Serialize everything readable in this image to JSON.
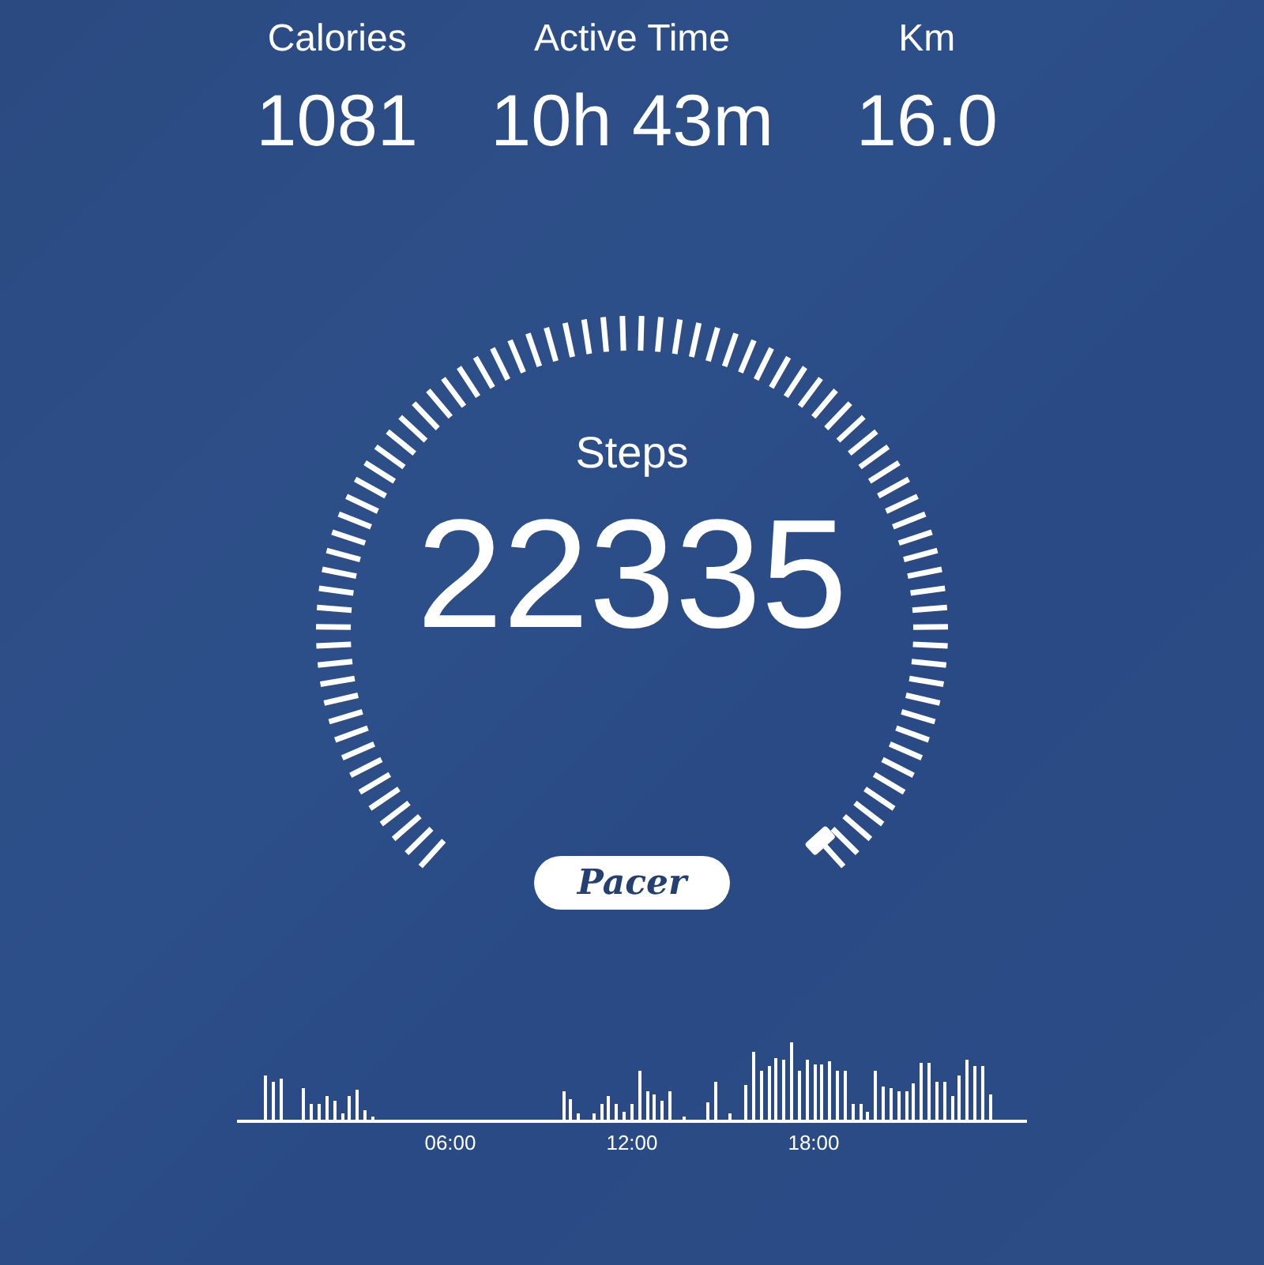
{
  "stats": [
    {
      "label": "Calories",
      "value": "1081"
    },
    {
      "label": "Active Time",
      "value": "10h 43m"
    },
    {
      "label": "Km",
      "value": "16.0"
    }
  ],
  "gauge": {
    "label": "Steps",
    "value": "22335"
  },
  "logo": "Pacer",
  "timeline": {
    "labels": [
      "06:00",
      "12:00",
      "18:00"
    ]
  }
}
